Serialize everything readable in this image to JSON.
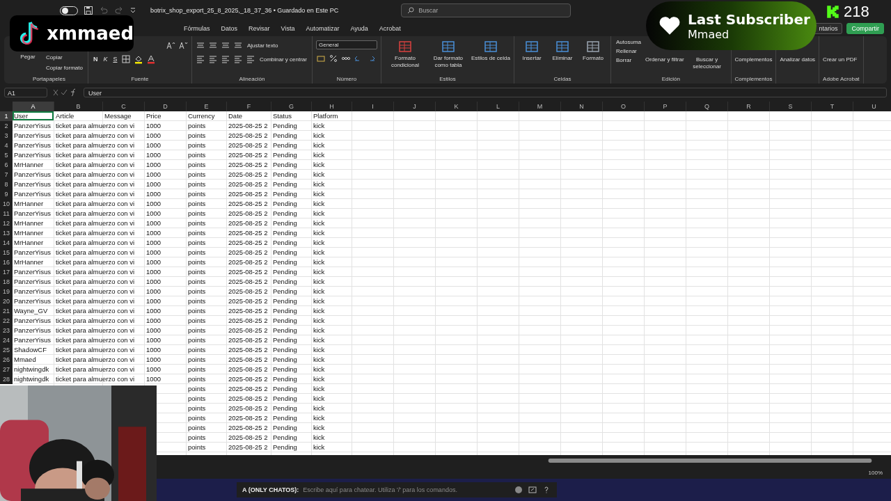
{
  "title_bar": {
    "autosave": {
      "on": false
    },
    "filename": "botrix_shop_export_25_8_2025,_18_37_36 • Guardado en Este PC",
    "search": {
      "placeholder": "Buscar"
    }
  },
  "menu_tabs": [
    {
      "label": "Fórmulas",
      "selected": false
    },
    {
      "label": "Datos",
      "selected": false
    },
    {
      "label": "Revisar",
      "selected": false
    },
    {
      "label": "Vista",
      "selected": false
    },
    {
      "label": "Automatizar",
      "selected": false
    },
    {
      "label": "Ayuda",
      "selected": false
    },
    {
      "label": "Acrobat",
      "selected": false
    }
  ],
  "header_buttons": [
    {
      "kind": "plain",
      "label": "ntarios"
    },
    {
      "kind": "share",
      "label": "Compartir"
    }
  ],
  "ribbon": [
    {
      "label": "Portapapeles",
      "items": [
        {
          "kind": "large",
          "label": "Pegar"
        },
        {
          "kind": "stack",
          "buttons": [
            "Copiar",
            "Copiar formato"
          ]
        }
      ]
    },
    {
      "label": "Fuente",
      "items": [
        {
          "kind": "font_tools",
          "buttons": [
            "N",
            "K",
            "S"
          ]
        }
      ]
    },
    {
      "label": "Alineación",
      "items": [
        {
          "kind": "align_tools",
          "buttons": [
            "Ajustar texto",
            "Combinar y centrar"
          ]
        }
      ]
    },
    {
      "label": "Número",
      "items": [
        {
          "kind": "number_tools",
          "value": "General"
        }
      ]
    },
    {
      "label": "Estilos",
      "items": [
        {
          "kind": "large",
          "label": "Formato condicional"
        },
        {
          "kind": "large",
          "label": "Dar formato como tabla"
        },
        {
          "kind": "large",
          "label": "Estilos de celda"
        }
      ]
    },
    {
      "label": "Celdas",
      "items": [
        {
          "kind": "large",
          "label": "Insertar"
        },
        {
          "kind": "large",
          "label": "Eliminar"
        },
        {
          "kind": "large",
          "label": "Formato"
        }
      ]
    },
    {
      "label": "Edición",
      "items": [
        {
          "kind": "stack",
          "buttons": [
            "Autosuma",
            "Rellenar",
            "Borrar"
          ]
        },
        {
          "kind": "large",
          "label": "Ordenar y filtrar"
        },
        {
          "kind": "large",
          "label": "Buscar y seleccionar"
        }
      ]
    },
    {
      "label": "Complementos",
      "items": [
        {
          "kind": "large",
          "label": "Complementos"
        }
      ]
    },
    {
      "items": [
        {
          "kind": "large",
          "label": "Analizar datos"
        }
      ]
    },
    {
      "label": "Adobe Acrobat",
      "items": [
        {
          "kind": "large",
          "label": "Crear un PDF"
        }
      ]
    }
  ],
  "formula_bar": {
    "name_box": "A1",
    "formula": "User"
  },
  "sheet": {
    "columns": [
      {
        "label": "A",
        "selected": true
      },
      {
        "label": "B",
        "selected": false
      },
      {
        "label": "C",
        "selected": false
      },
      {
        "label": "D",
        "selected": false
      },
      {
        "label": "E",
        "selected": false
      },
      {
        "label": "F",
        "selected": false
      },
      {
        "label": "G",
        "selected": false
      },
      {
        "label": "H",
        "selected": false
      },
      {
        "label": "I",
        "selected": false
      },
      {
        "label": "J",
        "selected": false
      },
      {
        "label": "K",
        "selected": false
      },
      {
        "label": "L",
        "selected": false
      },
      {
        "label": "M",
        "selected": false
      },
      {
        "label": "N",
        "selected": false
      },
      {
        "label": "O",
        "selected": false
      },
      {
        "label": "P",
        "selected": false
      },
      {
        "label": "Q",
        "selected": false
      },
      {
        "label": "R",
        "selected": false
      },
      {
        "label": "S",
        "selected": false
      },
      {
        "label": "T",
        "selected": false
      },
      {
        "label": "U",
        "selected": false
      }
    ],
    "rows": [
      {
        "number": "1",
        "selected": true,
        "A": "User",
        "B": "Article",
        "C": "Message",
        "D": "Price",
        "E": "Currency",
        "F": "Date",
        "G": "Status",
        "H": "Platform"
      },
      {
        "number": "2",
        "selected": false,
        "A": "PanzerYisus",
        "B": "ticket para almuerzo con vi",
        "D": "1000",
        "E": "points",
        "F": "2025-08-25 2",
        "G": "Pending",
        "H": "kick"
      },
      {
        "number": "3",
        "selected": false,
        "A": "PanzerYisus",
        "B": "ticket para almuerzo con vi",
        "D": "1000",
        "E": "points",
        "F": "2025-08-25 2",
        "G": "Pending",
        "H": "kick"
      },
      {
        "number": "4",
        "selected": false,
        "A": "PanzerYisus",
        "B": "ticket para almuerzo con vi",
        "D": "1000",
        "E": "points",
        "F": "2025-08-25 2",
        "G": "Pending",
        "H": "kick"
      },
      {
        "number": "5",
        "selected": false,
        "A": "PanzerYisus",
        "B": "ticket para almuerzo con vi",
        "D": "1000",
        "E": "points",
        "F": "2025-08-25 2",
        "G": "Pending",
        "H": "kick"
      },
      {
        "number": "6",
        "selected": false,
        "A": "MrHanner",
        "B": "ticket para almuerzo con vi",
        "D": "1000",
        "E": "points",
        "F": "2025-08-25 2",
        "G": "Pending",
        "H": "kick"
      },
      {
        "number": "7",
        "selected": false,
        "A": "PanzerYisus",
        "B": "ticket para almuerzo con vi",
        "D": "1000",
        "E": "points",
        "F": "2025-08-25 2",
        "G": "Pending",
        "H": "kick"
      },
      {
        "number": "8",
        "selected": false,
        "A": "PanzerYisus",
        "B": "ticket para almuerzo con vi",
        "D": "1000",
        "E": "points",
        "F": "2025-08-25 2",
        "G": "Pending",
        "H": "kick"
      },
      {
        "number": "9",
        "selected": false,
        "A": "PanzerYisus",
        "B": "ticket para almuerzo con vi",
        "D": "1000",
        "E": "points",
        "F": "2025-08-25 2",
        "G": "Pending",
        "H": "kick"
      },
      {
        "number": "10",
        "selected": false,
        "A": "MrHanner",
        "B": "ticket para almuerzo con vi",
        "D": "1000",
        "E": "points",
        "F": "2025-08-25 2",
        "G": "Pending",
        "H": "kick"
      },
      {
        "number": "11",
        "selected": false,
        "A": "PanzerYisus",
        "B": "ticket para almuerzo con vi",
        "D": "1000",
        "E": "points",
        "F": "2025-08-25 2",
        "G": "Pending",
        "H": "kick"
      },
      {
        "number": "12",
        "selected": false,
        "A": "MrHanner",
        "B": "ticket para almuerzo con vi",
        "D": "1000",
        "E": "points",
        "F": "2025-08-25 2",
        "G": "Pending",
        "H": "kick"
      },
      {
        "number": "13",
        "selected": false,
        "A": "MrHanner",
        "B": "ticket para almuerzo con vi",
        "D": "1000",
        "E": "points",
        "F": "2025-08-25 2",
        "G": "Pending",
        "H": "kick"
      },
      {
        "number": "14",
        "selected": false,
        "A": "MrHanner",
        "B": "ticket para almuerzo con vi",
        "D": "1000",
        "E": "points",
        "F": "2025-08-25 2",
        "G": "Pending",
        "H": "kick"
      },
      {
        "number": "15",
        "selected": false,
        "A": "PanzerYisus",
        "B": "ticket para almuerzo con vi",
        "D": "1000",
        "E": "points",
        "F": "2025-08-25 2",
        "G": "Pending",
        "H": "kick"
      },
      {
        "number": "16",
        "selected": false,
        "A": "MrHanner",
        "B": "ticket para almuerzo con vi",
        "D": "1000",
        "E": "points",
        "F": "2025-08-25 2",
        "G": "Pending",
        "H": "kick"
      },
      {
        "number": "17",
        "selected": false,
        "A": "PanzerYisus",
        "B": "ticket para almuerzo con vi",
        "D": "1000",
        "E": "points",
        "F": "2025-08-25 2",
        "G": "Pending",
        "H": "kick"
      },
      {
        "number": "18",
        "selected": false,
        "A": "PanzerYisus",
        "B": "ticket para almuerzo con vi",
        "D": "1000",
        "E": "points",
        "F": "2025-08-25 2",
        "G": "Pending",
        "H": "kick"
      },
      {
        "number": "19",
        "selected": false,
        "A": "PanzerYisus",
        "B": "ticket para almuerzo con vi",
        "D": "1000",
        "E": "points",
        "F": "2025-08-25 2",
        "G": "Pending",
        "H": "kick"
      },
      {
        "number": "20",
        "selected": false,
        "A": "PanzerYisus",
        "B": "ticket para almuerzo con vi",
        "D": "1000",
        "E": "points",
        "F": "2025-08-25 2",
        "G": "Pending",
        "H": "kick"
      },
      {
        "number": "21",
        "selected": false,
        "A": "Wayne_GV",
        "B": "ticket para almuerzo con vi",
        "D": "1000",
        "E": "points",
        "F": "2025-08-25 2",
        "G": "Pending",
        "H": "kick"
      },
      {
        "number": "22",
        "selected": false,
        "A": "PanzerYisus",
        "B": "ticket para almuerzo con vi",
        "D": "1000",
        "E": "points",
        "F": "2025-08-25 2",
        "G": "Pending",
        "H": "kick"
      },
      {
        "number": "23",
        "selected": false,
        "A": "PanzerYisus",
        "B": "ticket para almuerzo con vi",
        "D": "1000",
        "E": "points",
        "F": "2025-08-25 2",
        "G": "Pending",
        "H": "kick"
      },
      {
        "number": "24",
        "selected": false,
        "A": "PanzerYisus",
        "B": "ticket para almuerzo con vi",
        "D": "1000",
        "E": "points",
        "F": "2025-08-25 2",
        "G": "Pending",
        "H": "kick"
      },
      {
        "number": "25",
        "selected": false,
        "A": "ShadowCF",
        "B": "ticket para almuerzo con vi",
        "D": "1000",
        "E": "points",
        "F": "2025-08-25 2",
        "G": "Pending",
        "H": "kick"
      },
      {
        "number": "26",
        "selected": false,
        "A": "Mmaed",
        "B": "ticket para almuerzo con vi",
        "D": "1000",
        "E": "points",
        "F": "2025-08-25 2",
        "G": "Pending",
        "H": "kick"
      },
      {
        "number": "27",
        "selected": false,
        "A": "nightwingdk",
        "B": "ticket para almuerzo con vi",
        "D": "1000",
        "E": "points",
        "F": "2025-08-25 2",
        "G": "Pending",
        "H": "kick"
      },
      {
        "number": "28",
        "selected": false,
        "A": "nightwingdk",
        "B": "ticket para almuerzo con vi",
        "D": "1000",
        "E": "points",
        "F": "2025-08-25 2",
        "G": "Pending",
        "H": "kick"
      },
      {
        "E": "points",
        "F": "2025-08-25 2",
        "G": "Pending",
        "H": "kick"
      },
      {
        "E": "points",
        "F": "2025-08-25 2",
        "G": "Pending",
        "H": "kick"
      },
      {
        "E": "points",
        "F": "2025-08-25 2",
        "G": "Pending",
        "H": "kick"
      },
      {
        "E": "points",
        "F": "2025-08-25 2",
        "G": "Pending",
        "H": "kick"
      },
      {
        "E": "points",
        "F": "2025-08-25 2",
        "G": "Pending",
        "H": "kick"
      },
      {
        "E": "points",
        "F": "2025-08-25 2",
        "G": "Pending",
        "H": "kick"
      },
      {
        "E": "points",
        "F": "2025-08-25 2",
        "G": "Pending",
        "H": "kick"
      }
    ]
  },
  "status_bar": {
    "zoom": "100%"
  },
  "overlays": {
    "tiktok_badge": {
      "handle": "xmmaed"
    },
    "subscriber_alert": {
      "title": "Last Subscriber",
      "name": "Mmaed"
    },
    "viewer_count": {
      "count": "218"
    }
  },
  "chat": {
    "prefix": "A (ONLY CHATOS):",
    "placeholder": "Escribe aquí para chatear. Utiliza '/' para los comandos."
  }
}
